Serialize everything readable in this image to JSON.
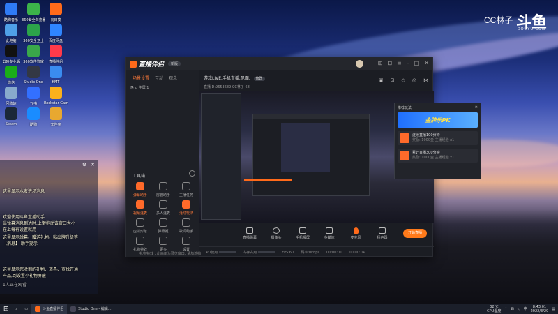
{
  "watermark": {
    "brand_cn": "CC林子",
    "brand_logo": "斗鱼",
    "domain": "DOUYU.COM"
  },
  "desktop_icons": [
    {
      "label": "酷狗音乐",
      "color": "#2f7bf6"
    },
    {
      "label": "360安全浏览器",
      "color": "#3cb34a"
    },
    {
      "label": "向日葵",
      "color": "#ff6a1a"
    },
    {
      "label": "此电脑",
      "color": "#4fa0e8"
    },
    {
      "label": "360安全卫士",
      "color": "#2ca44a"
    },
    {
      "label": "百度网盘",
      "color": "#2f86ff"
    },
    {
      "label": "剪映专业版",
      "color": "#111111"
    },
    {
      "label": "360软件管家",
      "color": "#3aa84a"
    },
    {
      "label": "直播伴侣",
      "color": "#ff3a4a"
    },
    {
      "label": "微信",
      "color": "#1aad19"
    },
    {
      "label": "Studio One",
      "color": "#333844"
    },
    {
      "label": "KMT",
      "color": "#3a8cf0"
    },
    {
      "label": "回收站",
      "color": "#88aacc"
    },
    {
      "label": "飞书",
      "color": "#3370ff"
    },
    {
      "label": "Rockstar Games",
      "color": "#fbb11b"
    },
    {
      "label": "Steam",
      "color": "#1b2838"
    },
    {
      "label": "酷狗",
      "color": "#1a8cff"
    },
    {
      "label": "文件夹",
      "color": "#e8a830"
    }
  ],
  "chat": {
    "messages": [
      "这里显示水友进场消息",
      "欢迎使用斗鱼直播助手",
      "当弹幕消息到达时,上键拖动该窗口大小",
      "在上每有设置就用",
      "这里显示弹幕、赠送礼物、粘出牌升级等",
      "【消息】 助手提示",
      "这里显示您收到的礼物、道具、查找开通",
      "产品,到设置小礼物屏蔽"
    ],
    "footer": "1人正在观看"
  },
  "app": {
    "title": "直播伴侣",
    "badge": "新版",
    "left_tabs": [
      "场景设置",
      "互动",
      "观众"
    ],
    "scene_label": "主屏 1",
    "tools_header": "工具箱",
    "tools": [
      {
        "label": "弹幕助手",
        "hot": true
      },
      {
        "label": "房管助手",
        "hot": false
      },
      {
        "label": "主播任务",
        "hot": false
      },
      {
        "label": "视频连麦",
        "hot": true
      },
      {
        "label": "多人连麦",
        "hot": false
      },
      {
        "label": "活动玩法",
        "hot": true
      },
      {
        "label": "虚拟形象",
        "hot": false
      },
      {
        "label": "弹幕姬",
        "hot": false
      },
      {
        "label": "歌词助手",
        "hot": false
      },
      {
        "label": "礼物特效",
        "hot": false
      },
      {
        "label": "更多",
        "hot": false
      },
      {
        "label": "设置",
        "hot": false
      }
    ],
    "stream_title": "游戏LIVE,手机直播,见面,",
    "stream_tag": "修改",
    "stream_sub": "直播ID:9653689  CC林子  68",
    "bottom_buttons": [
      "直播弹幕",
      "摄像头",
      "手机投屏",
      "多媒体",
      "麦克风",
      "扬声器"
    ],
    "start_label": "开始直播",
    "status": {
      "cpu": "CPU使用",
      "mem": "内存占用",
      "fps": "FPS:60",
      "bitrate": "码率:0kbps",
      "time1": "00:00:01",
      "time2": "00:00:04"
    },
    "notice": "礼物特效 , 此画面为预览窗口, 请勿遮挡"
  },
  "popup": {
    "title": "推荐玩法",
    "banner": "金牌乐PK",
    "items": [
      {
        "title": "连续直播100分钟",
        "sub": "奖励: 1000金 主播经验 x1"
      },
      {
        "title": "累计直播300分钟",
        "sub": "奖励: 1000金 主播经验 x1"
      }
    ]
  },
  "taskbar": {
    "apps": [
      "斗鱼直播伴侣",
      "Studio One - 编辑..."
    ],
    "weather": "32°C",
    "weather_sub": "CPU温度",
    "time": "8:43:01",
    "date": "2022/3/29"
  }
}
